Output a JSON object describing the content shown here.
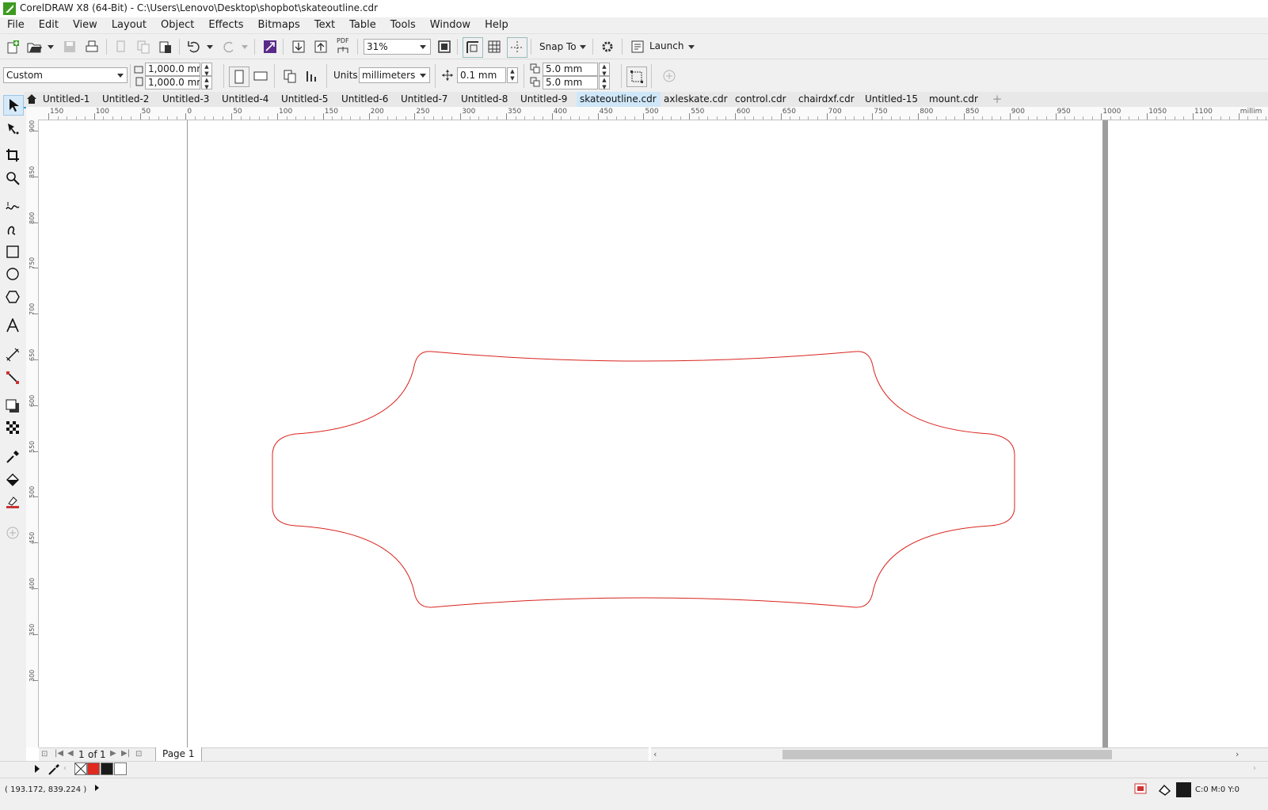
{
  "window": {
    "title": "CorelDRAW X8 (64-Bit) - C:\\Users\\Lenovo\\Desktop\\shopbot\\skateoutline.cdr"
  },
  "menu": [
    "File",
    "Edit",
    "View",
    "Layout",
    "Object",
    "Effects",
    "Bitmaps",
    "Text",
    "Table",
    "Tools",
    "Window",
    "Help"
  ],
  "standard_toolbar": {
    "zoom_value": "31%",
    "snap_to_label": "Snap To",
    "launch_label": "Launch",
    "pdf_label": "PDF"
  },
  "property_bar": {
    "page_preset": "Custom",
    "page_width": "1,000.0 mm",
    "page_height": "1,000.0 mm",
    "units_label": "Units:",
    "units_value": "millimeters",
    "nudge_value": "0.1 mm",
    "duplicate_x": "5.0 mm",
    "duplicate_y": "5.0 mm"
  },
  "document_tabs": [
    {
      "label": "Untitled-1",
      "active": false
    },
    {
      "label": "Untitled-2",
      "active": false
    },
    {
      "label": "Untitled-3",
      "active": false
    },
    {
      "label": "Untitled-4",
      "active": false
    },
    {
      "label": "Untitled-5",
      "active": false
    },
    {
      "label": "Untitled-6",
      "active": false
    },
    {
      "label": "Untitled-7",
      "active": false
    },
    {
      "label": "Untitled-8",
      "active": false
    },
    {
      "label": "Untitled-9",
      "active": false
    },
    {
      "label": "skateoutline.cdr",
      "active": true
    },
    {
      "label": "axleskate.cdr",
      "active": false
    },
    {
      "label": "control.cdr",
      "active": false
    },
    {
      "label": "chairdxf.cdr",
      "active": false
    },
    {
      "label": "Untitled-15",
      "active": false
    },
    {
      "label": "mount.cdr",
      "active": false
    }
  ],
  "ruler": {
    "horizontal_labels": [
      "150",
      "100",
      "50",
      "0",
      "50",
      "100",
      "150",
      "200",
      "250",
      "300",
      "350",
      "400",
      "450",
      "500",
      "550",
      "600",
      "650",
      "700",
      "750",
      "800",
      "850",
      "900",
      "950",
      "1000",
      "1050",
      "1100",
      "millim"
    ],
    "vertical_labels": [
      "900",
      "850",
      "800",
      "750",
      "700",
      "650",
      "600",
      "550",
      "500",
      "450",
      "400",
      "350",
      "300"
    ]
  },
  "drawing": {
    "outline_color": "#d9231d",
    "shape_name": "skateboard deck outline"
  },
  "page_navigator": {
    "current": "1",
    "of_label": "of",
    "total": "1",
    "page_tab": "Page 1"
  },
  "palette": {
    "swatches": [
      "none",
      "#e02a1f",
      "#1a1a1a",
      "#ffffff"
    ]
  },
  "status": {
    "coordinates": "( 193.172, 839.224 )",
    "fill_info": "C:0 M:0 Y:0"
  }
}
